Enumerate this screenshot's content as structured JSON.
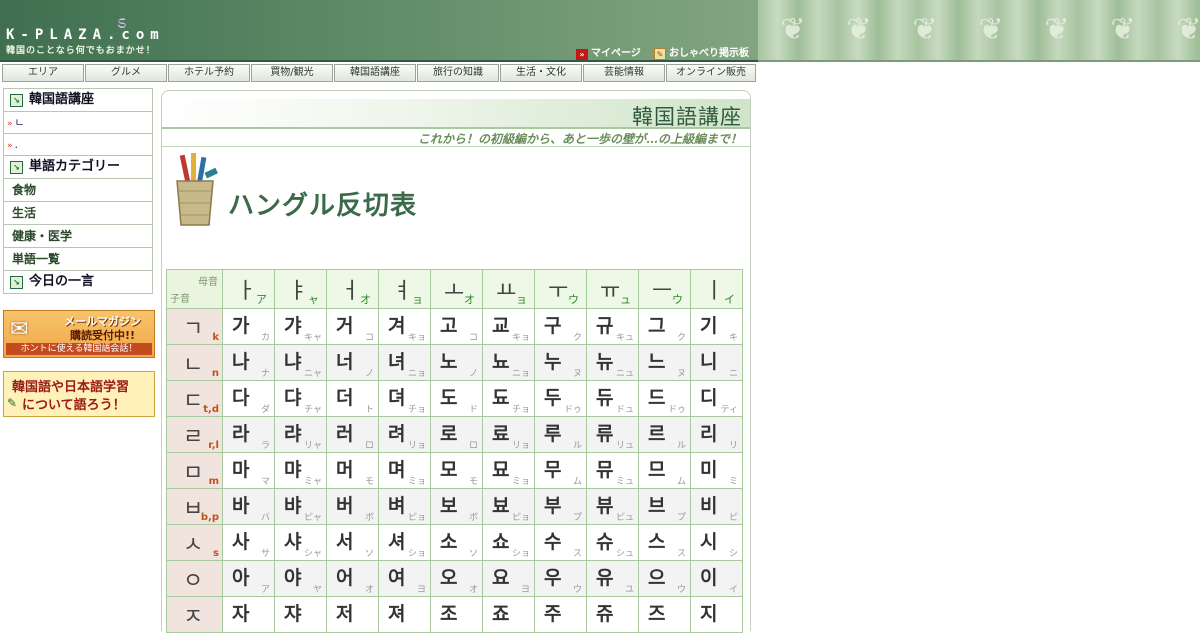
{
  "header": {
    "logo": "K-PLAZA.com",
    "tagline": "韓国のことなら何でもおまかせ！",
    "links": [
      "マイページ",
      "おしゃべり掲示板"
    ]
  },
  "nav": {
    "items": [
      "エリア",
      "グルメ",
      "ホテル予約",
      "買物/観光",
      "韓国語講座",
      "旅行の知識",
      "生活・文化",
      "芸能情報",
      "オンライン販売"
    ]
  },
  "sidebar": {
    "section1": "韓国語講座",
    "sub_items": [
      "ㄴ",
      "."
    ],
    "section2": "単語カテゴリー",
    "categories": [
      "食物",
      "生活",
      "健康・医学",
      "単語一覧"
    ],
    "section3": "今日の一言"
  },
  "banners": {
    "mail_line1": "メールマガジン",
    "mail_line2": "購読受付中!!",
    "mail_line3": "ホントに使える韓国語会話！",
    "talk_line1": "韓国語や日本語学習",
    "talk_line2": "について語ろう！"
  },
  "main": {
    "section_title": "韓国語講座",
    "subtitle": "これから！の初級編から、あと一歩の壁が…の上級編まで！",
    "page_title": "ハングル反切表"
  },
  "table": {
    "corner_top": "母音",
    "corner_bottom": "子音",
    "vowels": [
      {
        "jamo": "ㅏ",
        "kana": "ア"
      },
      {
        "jamo": "ㅑ",
        "kana": "ャ"
      },
      {
        "jamo": "ㅓ",
        "kana": "オ"
      },
      {
        "jamo": "ㅕ",
        "kana": "ョ"
      },
      {
        "jamo": "ㅗ",
        "kana": "オ"
      },
      {
        "jamo": "ㅛ",
        "kana": "ョ"
      },
      {
        "jamo": "ㅜ",
        "kana": "ウ"
      },
      {
        "jamo": "ㅠ",
        "kana": "ュ"
      },
      {
        "jamo": "ㅡ",
        "kana": "ウ"
      },
      {
        "jamo": "ㅣ",
        "kana": "イ"
      }
    ],
    "rows": [
      {
        "jamo": "ㄱ",
        "roman": "k",
        "cells": [
          [
            "가",
            "カ"
          ],
          [
            "갸",
            "キャ"
          ],
          [
            "거",
            "コ"
          ],
          [
            "겨",
            "キョ"
          ],
          [
            "고",
            "コ"
          ],
          [
            "교",
            "キョ"
          ],
          [
            "구",
            "ク"
          ],
          [
            "규",
            "キュ"
          ],
          [
            "그",
            "ク"
          ],
          [
            "기",
            "キ"
          ]
        ]
      },
      {
        "jamo": "ㄴ",
        "roman": "n",
        "cells": [
          [
            "나",
            "ナ"
          ],
          [
            "냐",
            "ニャ"
          ],
          [
            "너",
            "ノ"
          ],
          [
            "녀",
            "ニョ"
          ],
          [
            "노",
            "ノ"
          ],
          [
            "뇨",
            "ニョ"
          ],
          [
            "누",
            "ヌ"
          ],
          [
            "뉴",
            "ニュ"
          ],
          [
            "느",
            "ヌ"
          ],
          [
            "니",
            "ニ"
          ]
        ]
      },
      {
        "jamo": "ㄷ",
        "roman": "t,d",
        "cells": [
          [
            "다",
            "ダ"
          ],
          [
            "댜",
            "チャ"
          ],
          [
            "더",
            "ト"
          ],
          [
            "뎌",
            "チョ"
          ],
          [
            "도",
            "ド"
          ],
          [
            "됴",
            "チョ"
          ],
          [
            "두",
            "ドゥ"
          ],
          [
            "듀",
            "ドュ"
          ],
          [
            "드",
            "ドゥ"
          ],
          [
            "디",
            "ティ"
          ]
        ]
      },
      {
        "jamo": "ㄹ",
        "roman": "r,l",
        "cells": [
          [
            "라",
            "ラ"
          ],
          [
            "랴",
            "リャ"
          ],
          [
            "러",
            "ロ"
          ],
          [
            "려",
            "リョ"
          ],
          [
            "로",
            "ロ"
          ],
          [
            "료",
            "リョ"
          ],
          [
            "루",
            "ル"
          ],
          [
            "류",
            "リュ"
          ],
          [
            "르",
            "ル"
          ],
          [
            "리",
            "リ"
          ]
        ]
      },
      {
        "jamo": "ㅁ",
        "roman": "m",
        "cells": [
          [
            "마",
            "マ"
          ],
          [
            "먀",
            "ミャ"
          ],
          [
            "머",
            "モ"
          ],
          [
            "며",
            "ミョ"
          ],
          [
            "모",
            "モ"
          ],
          [
            "묘",
            "ミョ"
          ],
          [
            "무",
            "ム"
          ],
          [
            "뮤",
            "ミュ"
          ],
          [
            "므",
            "ム"
          ],
          [
            "미",
            "ミ"
          ]
        ]
      },
      {
        "jamo": "ㅂ",
        "roman": "b,p",
        "cells": [
          [
            "바",
            "バ"
          ],
          [
            "뱌",
            "ピャ"
          ],
          [
            "버",
            "ボ"
          ],
          [
            "벼",
            "ピョ"
          ],
          [
            "보",
            "ボ"
          ],
          [
            "뵤",
            "ピョ"
          ],
          [
            "부",
            "プ"
          ],
          [
            "뷰",
            "ピュ"
          ],
          [
            "브",
            "プ"
          ],
          [
            "비",
            "ピ"
          ]
        ]
      },
      {
        "jamo": "ㅅ",
        "roman": "s",
        "cells": [
          [
            "사",
            "サ"
          ],
          [
            "샤",
            "シャ"
          ],
          [
            "서",
            "ソ"
          ],
          [
            "셔",
            "ショ"
          ],
          [
            "소",
            "ソ"
          ],
          [
            "쇼",
            "ショ"
          ],
          [
            "수",
            "ス"
          ],
          [
            "슈",
            "シュ"
          ],
          [
            "스",
            "ス"
          ],
          [
            "시",
            "シ"
          ]
        ]
      },
      {
        "jamo": "ㅇ",
        "roman": "",
        "cells": [
          [
            "아",
            "ア"
          ],
          [
            "야",
            "ヤ"
          ],
          [
            "어",
            "オ"
          ],
          [
            "여",
            "ヨ"
          ],
          [
            "오",
            "オ"
          ],
          [
            "요",
            "ヨ"
          ],
          [
            "우",
            "ウ"
          ],
          [
            "유",
            "ユ"
          ],
          [
            "으",
            "ウ"
          ],
          [
            "이",
            "イ"
          ]
        ]
      },
      {
        "jamo": "ㅈ",
        "roman": "",
        "cells": [
          [
            "자",
            ""
          ],
          [
            "쟈",
            ""
          ],
          [
            "저",
            ""
          ],
          [
            "져",
            ""
          ],
          [
            "조",
            ""
          ],
          [
            "죠",
            ""
          ],
          [
            "주",
            ""
          ],
          [
            "쥬",
            ""
          ],
          [
            "즈",
            ""
          ],
          [
            "지",
            ""
          ]
        ]
      }
    ]
  },
  "colors": {
    "header_green": "#3f6f50",
    "table_border": "#a9c99e",
    "consonant_header_bg": "#f1e3dd",
    "roman_accent": "#c0541b"
  }
}
